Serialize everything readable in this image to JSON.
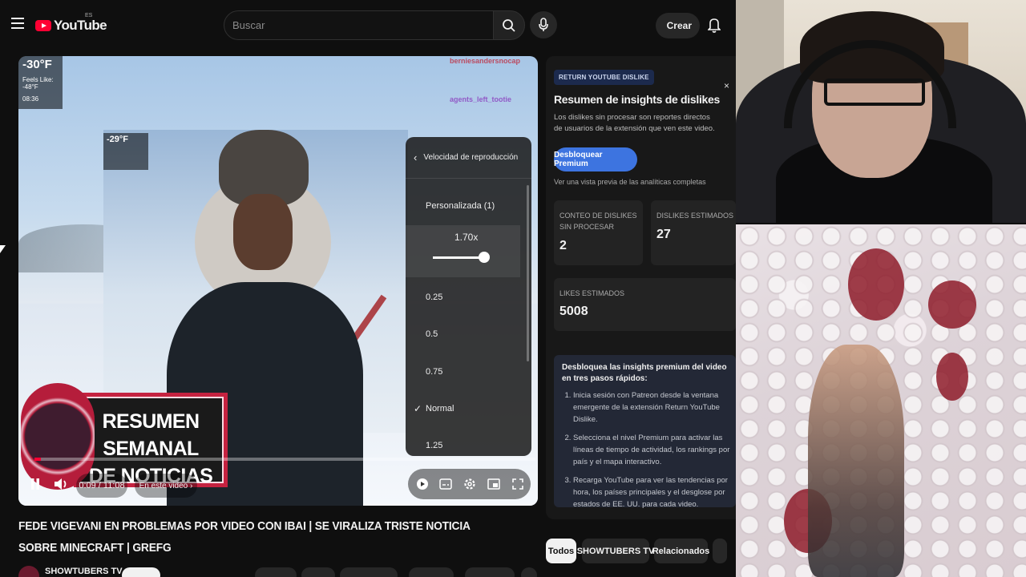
{
  "header": {
    "logo_text": "YouTube",
    "country_code": "ES",
    "search_placeholder": "Buscar",
    "create_label": "Crear"
  },
  "player": {
    "weather_main": {
      "temp": "-30°F",
      "line1": "Feels Like: -48°F",
      "line2": "08:36"
    },
    "weather_inner": {
      "temp": "-29°F"
    },
    "chat_lines": [
      "berniesandersnocap",
      "",
      "agents_left_tootie",
      ""
    ],
    "banner_text_line1": "RESUMEN SEMANAL",
    "banner_text_line2": "DE NOTICIAS",
    "time": "0:09 / 11:08",
    "chapter_label": "En este video",
    "progress_fraction": 0.013,
    "speed_menu": {
      "header": "Velocidad de reproducción",
      "custom_label": "Personalizada (1)",
      "custom_value": "1.70x",
      "options": [
        "0.25",
        "0.5",
        "0.75",
        "Normal",
        "1.25"
      ],
      "selected": "Normal"
    }
  },
  "video": {
    "title": "FEDE VIGEVANI EN PROBLEMAS POR VIDEO CON IBAI | SE VIRALIZA TRISTE NOTICIA SOBRE MINECRAFT | GREFG",
    "channel": "SHOWTUBERS TV"
  },
  "dislike_panel": {
    "badge": "RETURN YOUTUBE DISLIKE",
    "close": "×",
    "title": "Resumen de insights de dislikes",
    "description": "Los dislikes sin procesar son reportes directos de usuarios de la extensión que ven este video.",
    "unlock_button": "Desbloquear Premium",
    "preview_text": "Ver una vista previa de las analíticas completas",
    "stats": [
      {
        "label": "CONTEO DE DISLIKES SIN PROCESAR",
        "value": "2"
      },
      {
        "label": "DISLIKES ESTIMADOS",
        "value": "27"
      },
      {
        "label": "LIKES ESTIMADOS",
        "value": "5008"
      }
    ],
    "steps_heading": "Desbloquea las insights premium del video en tres pasos rápidos:",
    "steps": [
      "Inicia sesión con Patreon desde la ventana emergente de la extensión Return YouTube Dislike.",
      "Selecciona el nivel Premium para activar las líneas de tiempo de actividad, los rankings por país y el mapa interactivo.",
      "Recarga YouTube para ver las tendencias por hora, los países principales y el desglose por estados de EE. UU. para cada video."
    ]
  },
  "chips": [
    "Todos",
    "SHOWTUBERS TV",
    "Relacionados"
  ],
  "colors": {
    "brand_red": "#ff0033",
    "accent_blue": "#3d74e0",
    "background": "#0f0f0f"
  }
}
